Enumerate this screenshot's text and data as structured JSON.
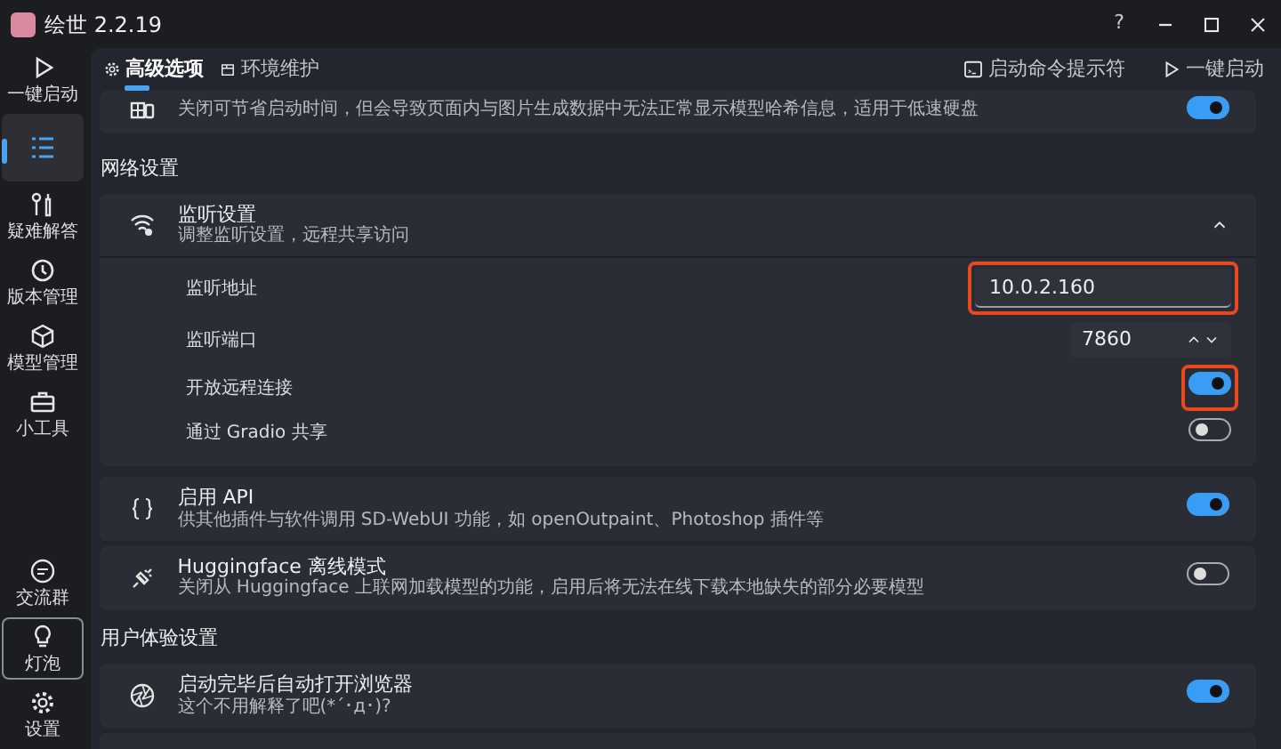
{
  "window": {
    "title": "绘世 2.2.19",
    "help": "?"
  },
  "sidebar": {
    "top_items": [
      {
        "kind": "play",
        "label": "一键启动",
        "selected": false,
        "focused": false
      },
      {
        "kind": "list",
        "selected": true,
        "focused": false
      },
      {
        "kind": "tools",
        "label": "疑难解答",
        "selected": false,
        "focused": false
      },
      {
        "kind": "history",
        "label": "版本管理",
        "selected": false,
        "focused": false
      },
      {
        "kind": "cube",
        "label": "模型管理",
        "selected": false,
        "focused": false
      },
      {
        "kind": "toolbox",
        "label": "小工具",
        "selected": false,
        "focused": false
      }
    ],
    "bottom_items": [
      {
        "kind": "chat",
        "label": "交流群",
        "selected": false,
        "focused": false
      },
      {
        "kind": "bulb",
        "label": "灯泡",
        "selected": false,
        "focused": true
      },
      {
        "kind": "gear",
        "label": "设置",
        "selected": false,
        "focused": false
      }
    ]
  },
  "toolbar": {
    "tabs": [
      {
        "kind": "gear",
        "label": "高级选项",
        "selected": true
      },
      {
        "kind": "box",
        "label": "环境维护",
        "selected": false
      }
    ],
    "actions": [
      {
        "kind": "terminal",
        "label": "启动命令提示符"
      },
      {
        "kind": "play",
        "label": "一键启动"
      }
    ]
  },
  "content": [
    {
      "kind": "card",
      "description": "关闭可节省启动时间，但会导致页面内与图片生成数据中无法正常显示模型哈希信息，适用于低速硬盘",
      "on": true
    },
    {
      "kind": "heading",
      "text": "网络设置"
    },
    {
      "kind": "expander",
      "title": "监听设置",
      "description": "调整监听设置，远程共享访问",
      "expanded": true,
      "rows": [
        {
          "kind": "text",
          "label": "监听地址",
          "value": "10.0.2.160",
          "highlighted": true
        },
        {
          "kind": "number",
          "label": "监听端口",
          "value": "7860",
          "highlighted": false
        },
        {
          "kind": "toggle",
          "label": "开放远程连接",
          "on": true,
          "highlighted": true
        },
        {
          "kind": "toggle",
          "label": "通过 Gradio 共享",
          "on": false,
          "highlighted": false
        }
      ]
    },
    {
      "kind": "card",
      "title": "启用 API",
      "description": "供其他插件与软件调用 SD-WebUI 功能，如 openOutpaint、Photoshop 插件等",
      "on": true
    },
    {
      "kind": "card",
      "title": "Huggingface 离线模式",
      "description": "关闭从 Huggingface 上联网加载模型的功能，启用后将无法在线下载本地缺失的部分必要模型",
      "on": false
    },
    {
      "kind": "heading",
      "text": "用户体验设置"
    },
    {
      "kind": "card",
      "title": "启动完毕后自动打开浏览器",
      "description": "这个不用解释了吧(*´･д･)?",
      "on": true
    },
    {
      "kind": "stub"
    }
  ]
}
